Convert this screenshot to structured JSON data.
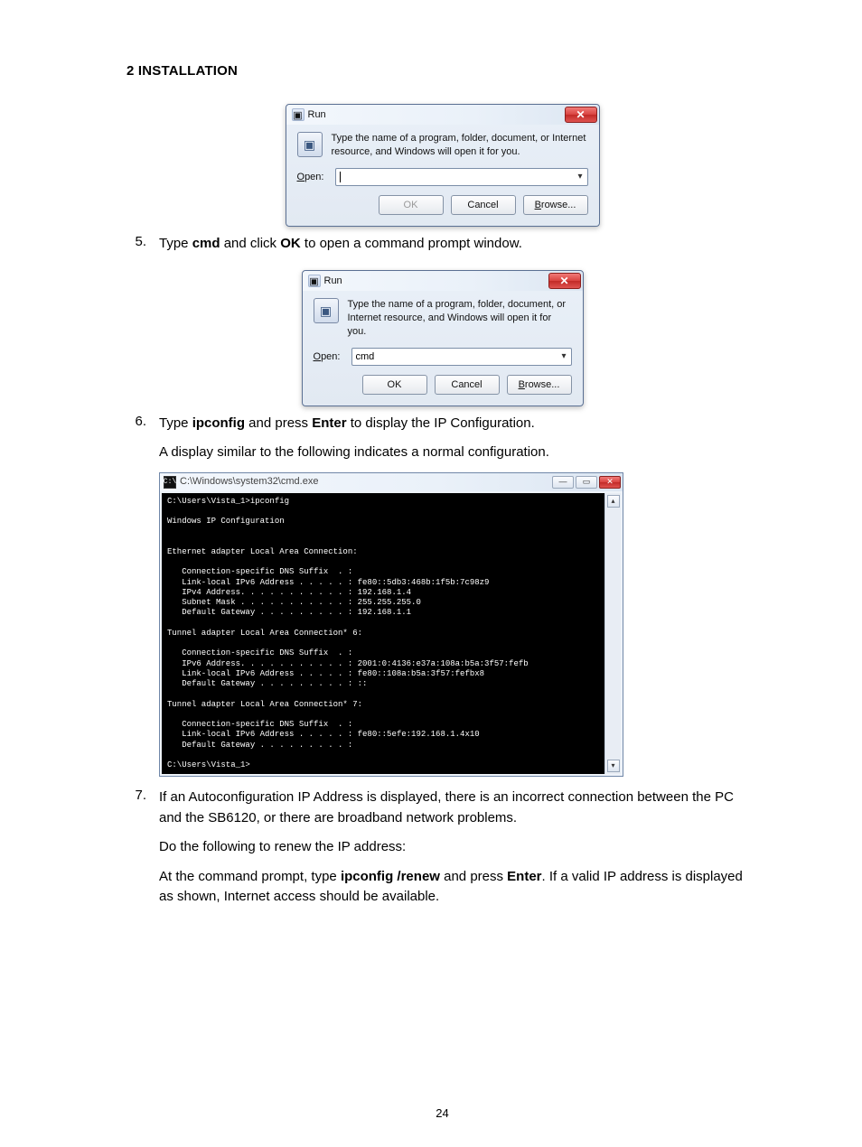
{
  "heading": "2 INSTALLATION",
  "run_dialog_common": {
    "title": "Run",
    "close_glyph": "✕",
    "desc": "Type the name of a program, folder, document, or Internet resource, and Windows will open it for you.",
    "open_label_underline": "O",
    "open_label_rest": "pen:",
    "ok": "OK",
    "cancel": "Cancel",
    "browse_u": "B",
    "browse_rest": "rowse...",
    "caret": "▾"
  },
  "run1": {
    "value": ""
  },
  "run2": {
    "value": "cmd"
  },
  "steps": {
    "s5": {
      "num": "5.",
      "pre": "Type ",
      "cmd_b": "cmd",
      "mid": " and click ",
      "ok_b": "OK",
      "post": " to open a command prompt window."
    },
    "s6": {
      "num": "6.",
      "pre": "Type ",
      "ip_b": "ipconfig",
      "mid": " and press ",
      "enter_b": "Enter",
      "post": " to display the IP Configuration.",
      "p2": "A display similar to the following indicates a normal configuration."
    },
    "s7": {
      "num": "7.",
      "p1": "If an Autoconfiguration IP Address is displayed, there is an incorrect connection between the PC and the SB6120, or there are broadband network problems.",
      "p2": "Do the following to renew the IP address:",
      "p3_pre": "At the command prompt, type ",
      "p3_b1": "ipconfig /renew",
      "p3_mid": " and press ",
      "p3_b2": "Enter",
      "p3_post": ". If a valid IP address is displayed as shown, Internet access should be available."
    }
  },
  "cmd": {
    "title": "C:\\Windows\\system32\\cmd.exe",
    "min": "—",
    "max": "▭",
    "close": "✕",
    "up": "▴",
    "down": "▾",
    "text": "C:\\Users\\Vista_1>ipconfig\n\nWindows IP Configuration\n\n\nEthernet adapter Local Area Connection:\n\n   Connection-specific DNS Suffix  . :\n   Link-local IPv6 Address . . . . . : fe80::5db3:468b:1f5b:7c98z9\n   IPv4 Address. . . . . . . . . . . : 192.168.1.4\n   Subnet Mask . . . . . . . . . . . : 255.255.255.0\n   Default Gateway . . . . . . . . . : 192.168.1.1\n\nTunnel adapter Local Area Connection* 6:\n\n   Connection-specific DNS Suffix  . :\n   IPv6 Address. . . . . . . . . . . : 2001:0:4136:e37a:108a:b5a:3f57:fefb\n   Link-local IPv6 Address . . . . . : fe80::108a:b5a:3f57:fefbx8\n   Default Gateway . . . . . . . . . : ::\n\nTunnel adapter Local Area Connection* 7:\n\n   Connection-specific DNS Suffix  . :\n   Link-local IPv6 Address . . . . . : fe80::5efe:192.168.1.4x10\n   Default Gateway . . . . . . . . . :\n\nC:\\Users\\Vista_1>"
  },
  "page_number": "24"
}
